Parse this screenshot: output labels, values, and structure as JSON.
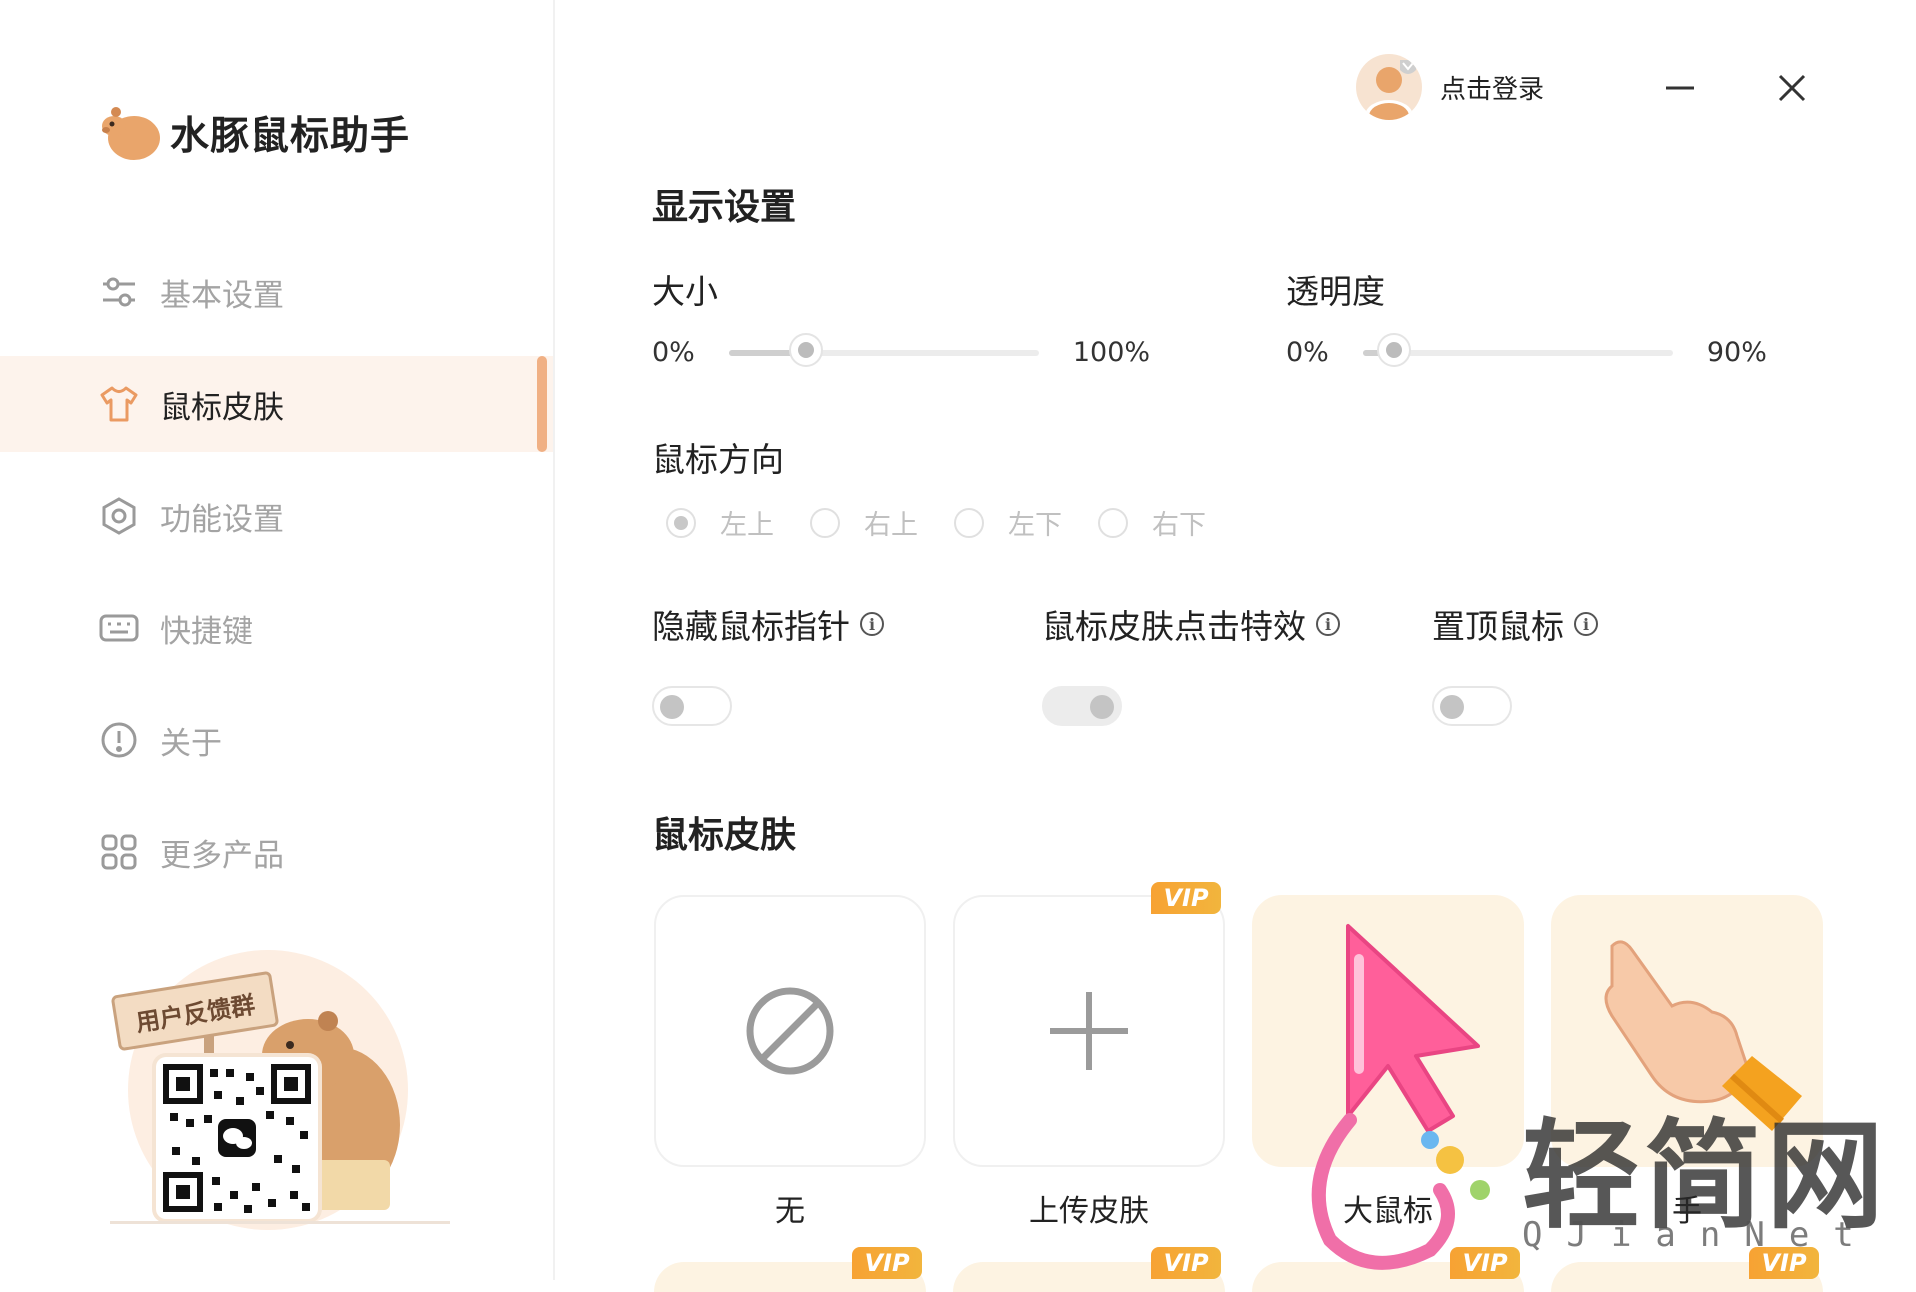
{
  "app": {
    "name": "水豚鼠标助手"
  },
  "sidebar": {
    "items": [
      {
        "label": "基本设置",
        "icon": "sliders-icon",
        "active": false
      },
      {
        "label": "鼠标皮肤",
        "icon": "shirt-icon",
        "active": true
      },
      {
        "label": "功能设置",
        "icon": "hexagon-settings-icon",
        "active": false
      },
      {
        "label": "快捷键",
        "icon": "keyboard-icon",
        "active": false
      },
      {
        "label": "关于",
        "icon": "info-circle-icon",
        "active": false
      },
      {
        "label": "更多产品",
        "icon": "grid-icon",
        "active": false
      }
    ],
    "feedback": {
      "sign": "用户反馈群"
    }
  },
  "header": {
    "login": "点击登录"
  },
  "display": {
    "title": "显示设置",
    "size": {
      "label": "大小",
      "min": "0%",
      "max": "100%",
      "value": 0.25
    },
    "opacity": {
      "label": "透明度",
      "min": "0%",
      "max": "90%",
      "value": 0.1
    },
    "direction": {
      "label": "鼠标方向",
      "options": [
        "左上",
        "右上",
        "左下",
        "右下"
      ],
      "selected": 0
    },
    "toggles": [
      {
        "label": "隐藏鼠标指针",
        "on": false
      },
      {
        "label": "鼠标皮肤点击特效",
        "on": true
      },
      {
        "label": "置顶鼠标",
        "on": false
      }
    ]
  },
  "skins": {
    "title": "鼠标皮肤",
    "items": [
      {
        "name": "无",
        "vip": false,
        "icon": "no-symbol-icon"
      },
      {
        "name": "上传皮肤",
        "vip": true,
        "icon": "plus-icon"
      },
      {
        "name": "大鼠标",
        "vip": false,
        "icon": "big-pink-cursor-icon"
      },
      {
        "name": "手",
        "vip": false,
        "icon": "pointing-hand-icon"
      }
    ],
    "vip_badge": "VIP",
    "row2_vip": [
      "VIP",
      "VIP",
      "VIP",
      "VIP"
    ]
  },
  "watermark": {
    "big": "轻简网",
    "small": "QJianNet"
  },
  "colors": {
    "accent": "#f0b084",
    "active_bg": "#fdf3ec",
    "vip": "#f7a233"
  }
}
